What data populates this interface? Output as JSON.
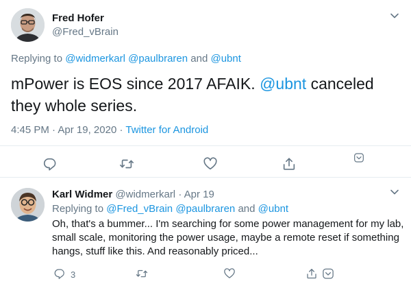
{
  "main_tweet": {
    "author_name": "Fred Hofer",
    "author_handle": "@Fred_vBrain",
    "replying_prefix": "Replying to",
    "replying_mentions": [
      "@widmerkarl",
      "@paulbraren",
      "@ubnt"
    ],
    "replying_and": "and",
    "text_part1": "mPower is EOS since 2017 AFAIK.",
    "text_mention": "@ubnt",
    "text_part2": "canceled they whole series.",
    "time": "4:45 PM",
    "date": "Apr 19, 2020",
    "separator": "·",
    "source": "Twitter for Android"
  },
  "reply_tweet": {
    "author_name": "Karl Widmer",
    "author_handle": "@widmerkarl",
    "separator": "·",
    "date": "Apr 19",
    "replying_prefix": "Replying to",
    "replying_mentions": [
      "@Fred_vBrain",
      "@paulbraren",
      "@ubnt"
    ],
    "replying_and": "and",
    "text": "Oh, that's a bummer... I'm searching for some power management for my lab, small scale, monitoring the power usage, maybe a remote reset if something hangs, stuff like this. And reasonably priced...",
    "reply_count": "3"
  },
  "icons": {
    "reply": "reply-icon",
    "retweet": "retweet-icon",
    "like": "heart-icon",
    "share": "share-icon",
    "more": "chevron-down-icon"
  },
  "colors": {
    "link": "#1b95e0",
    "secondary_text": "#657786",
    "primary_text": "#14171a",
    "divider": "#e6ecf0"
  }
}
